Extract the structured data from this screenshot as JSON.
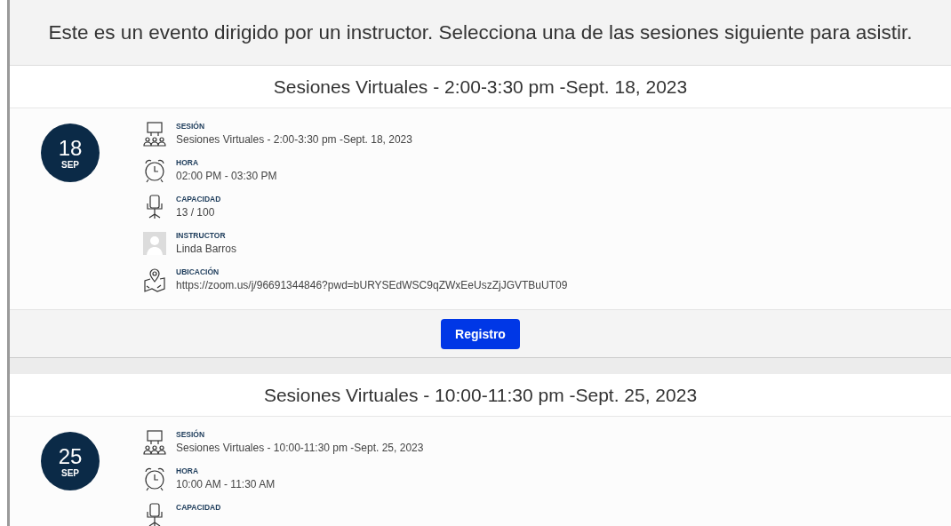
{
  "header": {
    "text": "Este es un evento dirigido por un instructor. Selecciona una de las sesiones siguiente para asistir."
  },
  "sessions": [
    {
      "title": "Sesiones Virtuales - 2:00-3:30 pm -Sept. 18, 2023",
      "day": "18",
      "month": "SEP",
      "details": [
        {
          "kind": "session",
          "label": "SESIÓN",
          "value": "Sesiones Virtuales - 2:00-3:30 pm -Sept. 18, 2023"
        },
        {
          "kind": "time",
          "label": "HORA",
          "value": "02:00 PM - 03:30 PM"
        },
        {
          "kind": "capacity",
          "label": "CAPACIDAD",
          "value": "13 / 100"
        },
        {
          "kind": "instructor",
          "label": "INSTRUCTOR",
          "value": "Linda Barros"
        },
        {
          "kind": "location",
          "label": "UBICACIÓN",
          "value": "https://zoom.us/j/96691344846?pwd=bURYSEdWSC9qZWxEeUszZjJGVTBuUT09"
        }
      ],
      "button": "Registro"
    },
    {
      "title": "Sesiones Virtuales - 10:00-11:30 pm -Sept. 25, 2023",
      "day": "25",
      "month": "SEP",
      "details": [
        {
          "kind": "session",
          "label": "SESIÓN",
          "value": "Sesiones Virtuales - 10:00-11:30 pm -Sept. 25, 2023"
        },
        {
          "kind": "time",
          "label": "HORA",
          "value": "10:00 AM - 11:30 AM"
        },
        {
          "kind": "capacity",
          "label": "CAPACIDAD"
        }
      ]
    }
  ]
}
